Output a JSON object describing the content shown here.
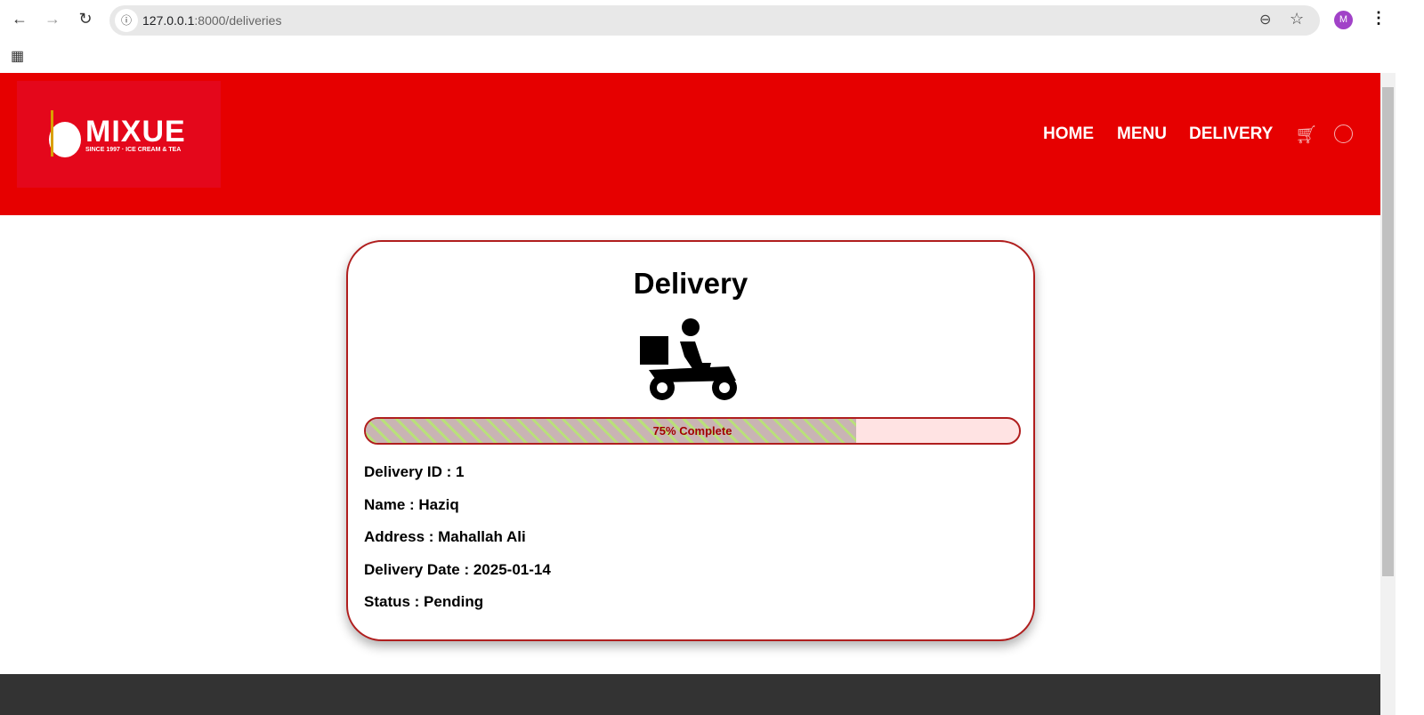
{
  "browser": {
    "url_host": "127.0.0.1",
    "url_path": ":8000/deliveries",
    "avatar": "M"
  },
  "logo": {
    "name": "MIXUE",
    "tagline": "SINCE 1997 · ICE CREAM & TEA"
  },
  "nav": {
    "items": [
      "HOME",
      "MENU",
      "DELIVERY"
    ]
  },
  "card": {
    "title": "Delivery",
    "progress_percent": 75,
    "progress_label": "75% Complete",
    "fields": [
      "Delivery ID : 1",
      "Name : Haziq",
      "Address : Mahallah Ali",
      "Delivery Date : 2025-01-14",
      "Status : Pending"
    ]
  },
  "colors": {
    "header": "#e60000",
    "accent": "#b01e1e",
    "footer": "#333333"
  }
}
